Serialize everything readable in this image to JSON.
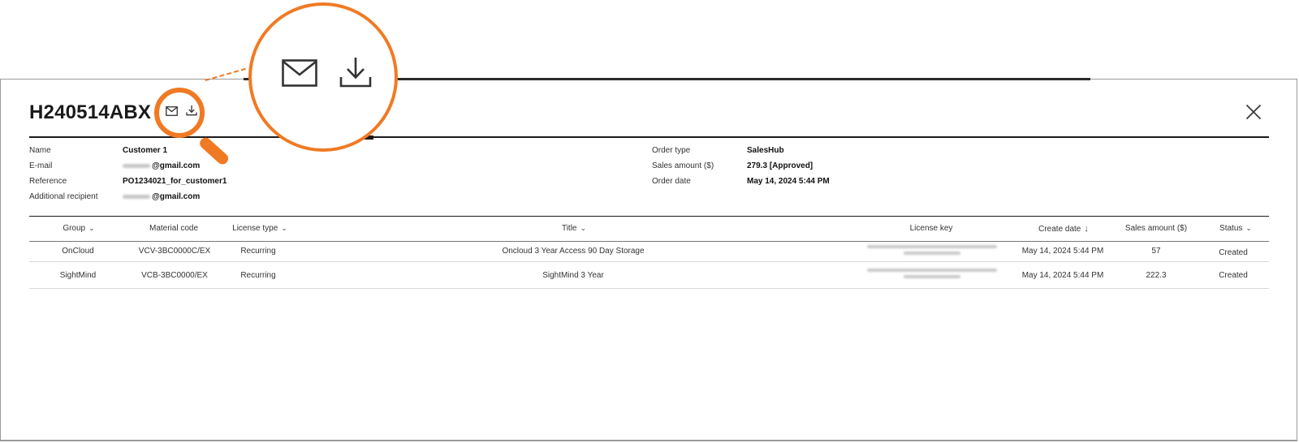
{
  "order": {
    "id": "H240514ABX"
  },
  "details_left": [
    {
      "label": "Name",
      "value": "Customer 1"
    },
    {
      "label": "E-mail",
      "value": "@gmail.com"
    },
    {
      "label": "Reference",
      "value": "PO1234021_for_customer1"
    },
    {
      "label": "Additional recipient",
      "value": "@gmail.com"
    }
  ],
  "details_right": [
    {
      "label": "Order type",
      "value": "SalesHub"
    },
    {
      "label": "Sales amount ($)",
      "value": "279.3 [Approved]"
    },
    {
      "label": "Order date",
      "value": "May 14, 2024 5:44 PM"
    }
  ],
  "table": {
    "headers": {
      "group": "Group",
      "material_code": "Material code",
      "license_type": "License type",
      "title": "Title",
      "license_key": "License key",
      "create_date": "Create date",
      "sales_amount": "Sales amount ($)",
      "status": "Status"
    },
    "rows": [
      {
        "group": "OnCloud",
        "material_code": "VCV-3BC0000C/EX",
        "license_type": "Recurring",
        "title": "Oncloud 3 Year Access 90 Day Storage",
        "create_date": "May 14, 2024 5:44 PM",
        "sales_amount": "57",
        "status": "Created"
      },
      {
        "group": "SightMind",
        "material_code": "VCB-3BC0000/EX",
        "license_type": "Recurring",
        "title": "SightMind 3 Year",
        "create_date": "May 14, 2024 5:44 PM",
        "sales_amount": "222.3",
        "status": "Created"
      }
    ]
  },
  "icons": {
    "email": "email-icon",
    "download": "download-icon",
    "close": "close-icon",
    "magnifier": "magnifier-callout"
  },
  "colors": {
    "accent": "#f07a24",
    "text": "#1a1a1a"
  }
}
